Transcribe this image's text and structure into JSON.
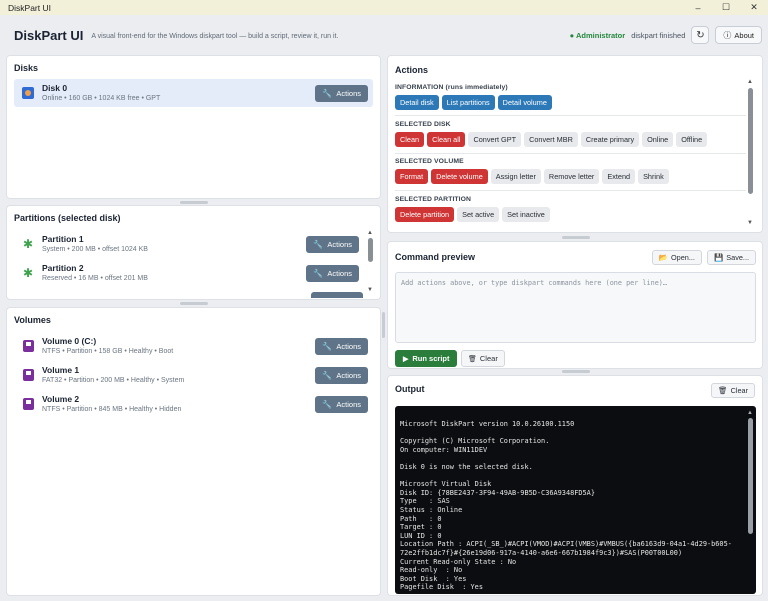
{
  "window": {
    "title": "DiskPart UI",
    "controls": [
      "–",
      "☐",
      "✕"
    ]
  },
  "header": {
    "title": "DiskPart UI",
    "subtitle": "A visual front-end for the Windows diskpart tool — build a script, review it, run it.",
    "admin_label": "● Administrator",
    "status": "diskpart finished",
    "refresh_glyph": "↻",
    "about_icon": "ⓘ",
    "about_label": "About"
  },
  "disks": {
    "title": "Disks",
    "items": [
      {
        "name": "Disk 0",
        "meta": "Online • 160 GB • 1024 KB free • GPT",
        "action": "Actions"
      }
    ]
  },
  "partitions": {
    "title": "Partitions (selected disk)",
    "items": [
      {
        "name": "Partition 1",
        "meta": "System • 200 MB • offset 1024 KB",
        "action": "Actions"
      },
      {
        "name": "Partition 2",
        "meta": "Reserved • 16 MB • offset 201 MB",
        "action": "Actions"
      }
    ]
  },
  "volumes": {
    "title": "Volumes",
    "items": [
      {
        "name": "Volume 0 (C:)",
        "meta": "NTFS • Partition • 158 GB • Healthy • Boot",
        "action": "Actions"
      },
      {
        "name": "Volume 1",
        "meta": "FAT32 • Partition • 200 MB • Healthy • System",
        "action": "Actions"
      },
      {
        "name": "Volume 2",
        "meta": "NTFS • Partition • 845 MB • Healthy • Hidden",
        "action": "Actions"
      }
    ]
  },
  "actions": {
    "title": "Actions",
    "groups": [
      {
        "label": "INFORMATION (RUNS IMMEDIATELY)",
        "buttons": [
          "Detail disk",
          "List partitions",
          "Detail volume"
        ]
      },
      {
        "label": "SELECTED DISK",
        "buttons": [
          "Clean",
          "Clean all",
          "Convert GPT",
          "Convert MBR",
          "Create primary",
          "Online",
          "Offline"
        ]
      },
      {
        "label": "SELECTED VOLUME",
        "buttons": [
          "Format",
          "Delete volume",
          "Assign letter",
          "Remove letter",
          "Extend",
          "Shrink"
        ]
      },
      {
        "label": "SELECTED PARTITION",
        "buttons": [
          "Delete partition",
          "Set active",
          "Set inactive"
        ]
      }
    ]
  },
  "preview": {
    "title": "Command preview",
    "open_label": "Open...",
    "save_label": "Save...",
    "placeholder": "Add actions above, or type diskpart commands here (one per line)…",
    "run_label": "Run script",
    "clear_label": "Clear"
  },
  "output": {
    "title": "Output",
    "clear_label": "Clear",
    "lines": [
      "Microsoft DiskPart version 10.0.26100.1150",
      "",
      "Copyright (C) Microsoft Corporation.",
      "On computer: WIN11DEV",
      "",
      "Disk 0 is now the selected disk.",
      "",
      "Microsoft Virtual Disk",
      "Disk ID: {78BE2437-3F94-49AB-9B5D-C36A9348FD5A}",
      "Type   : SAS",
      "Status : Online",
      "Path   : 0",
      "Target : 0",
      "LUN ID : 0",
      "Location Path : ACPI(_SB_)#ACPI(VMOD)#ACPI(VMBS)#VMBUS({ba6163d9-04a1-4d29-b605-",
      "72e2ffb1dc7f}#{26e19d06-917a-4140-a6e6-667b1984f9c3})#SAS(P00T00L00)",
      "Current Read-only State : No",
      "Read-only  : No",
      "Boot Disk  : Yes",
      "Pagefile Disk  : Yes"
    ]
  },
  "colors": {
    "accent_blue": "#2d79b8",
    "danger_red": "#cf3535",
    "run_green": "#2a7d3a",
    "admin_green": "#24873c"
  }
}
